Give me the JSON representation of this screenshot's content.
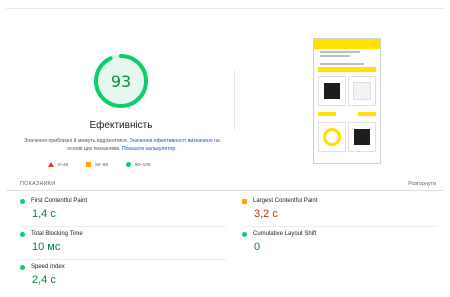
{
  "score": {
    "value": "93",
    "fraction": 0.93,
    "title": "Ефективність"
  },
  "description": {
    "text1": "Значення приблизні й можуть відрізнятися. ",
    "link1": "Значення ефективності визначено",
    "text2": " на основі цих показників. ",
    "link2": "Показати калькулятор."
  },
  "legend": {
    "fail": "0–49",
    "average": "50–89",
    "pass": "90–100"
  },
  "metrics_section": {
    "title": "ПОКАЗНИКИ",
    "expand": "Розгорнути"
  },
  "metrics": {
    "fcp": {
      "label": "First Contentful Paint",
      "value": "1,4 с"
    },
    "lcp": {
      "label": "Largest Contentful Paint",
      "value": "3,2 с"
    },
    "tbt": {
      "label": "Total Blocking Time",
      "value": "10 мс"
    },
    "cls": {
      "label": "Cumulative Layout Shift",
      "value": "0"
    },
    "si": {
      "label": "Speed Index",
      "value": "2,4 с"
    }
  },
  "colors": {
    "pass": "#0cce6b",
    "average": "#ffa400",
    "fail": "#e53935",
    "link": "#1a56c8"
  }
}
